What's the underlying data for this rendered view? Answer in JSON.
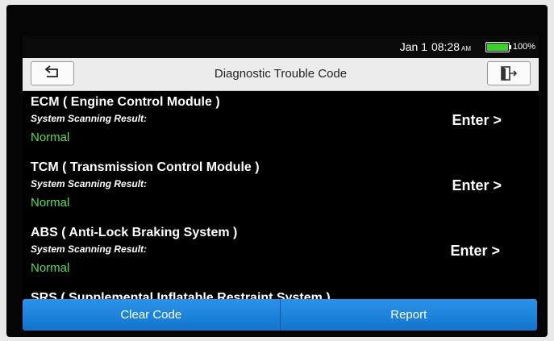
{
  "status_bar": {
    "date": "Jan 1",
    "time": "08:28",
    "ampm": "AM",
    "battery_percent": "100%",
    "battery_level": 1.0,
    "battery_color": "#39d12a"
  },
  "header": {
    "title": "Diagnostic Trouble Code",
    "back_icon": "back-arrow-icon",
    "exit_icon": "exit-door-icon"
  },
  "systems": [
    {
      "name": "ECM ( Engine Control Module )",
      "scan_label": "System Scanning Result:",
      "result": "Normal",
      "action": "Enter >"
    },
    {
      "name": "TCM ( Transmission Control Module )",
      "scan_label": "System Scanning Result:",
      "result": "Normal",
      "action": "Enter >"
    },
    {
      "name": "ABS ( Anti-Lock Braking System )",
      "scan_label": "System Scanning Result:",
      "result": "Normal",
      "action": "Enter >"
    },
    {
      "name": "SRS ( Supplemental Inflatable Restraint System )"
    }
  ],
  "footer": {
    "clear_label": "Clear Code",
    "report_label": "Report"
  },
  "colors": {
    "accent": "#1d86dc",
    "normal": "#4fe04a"
  }
}
